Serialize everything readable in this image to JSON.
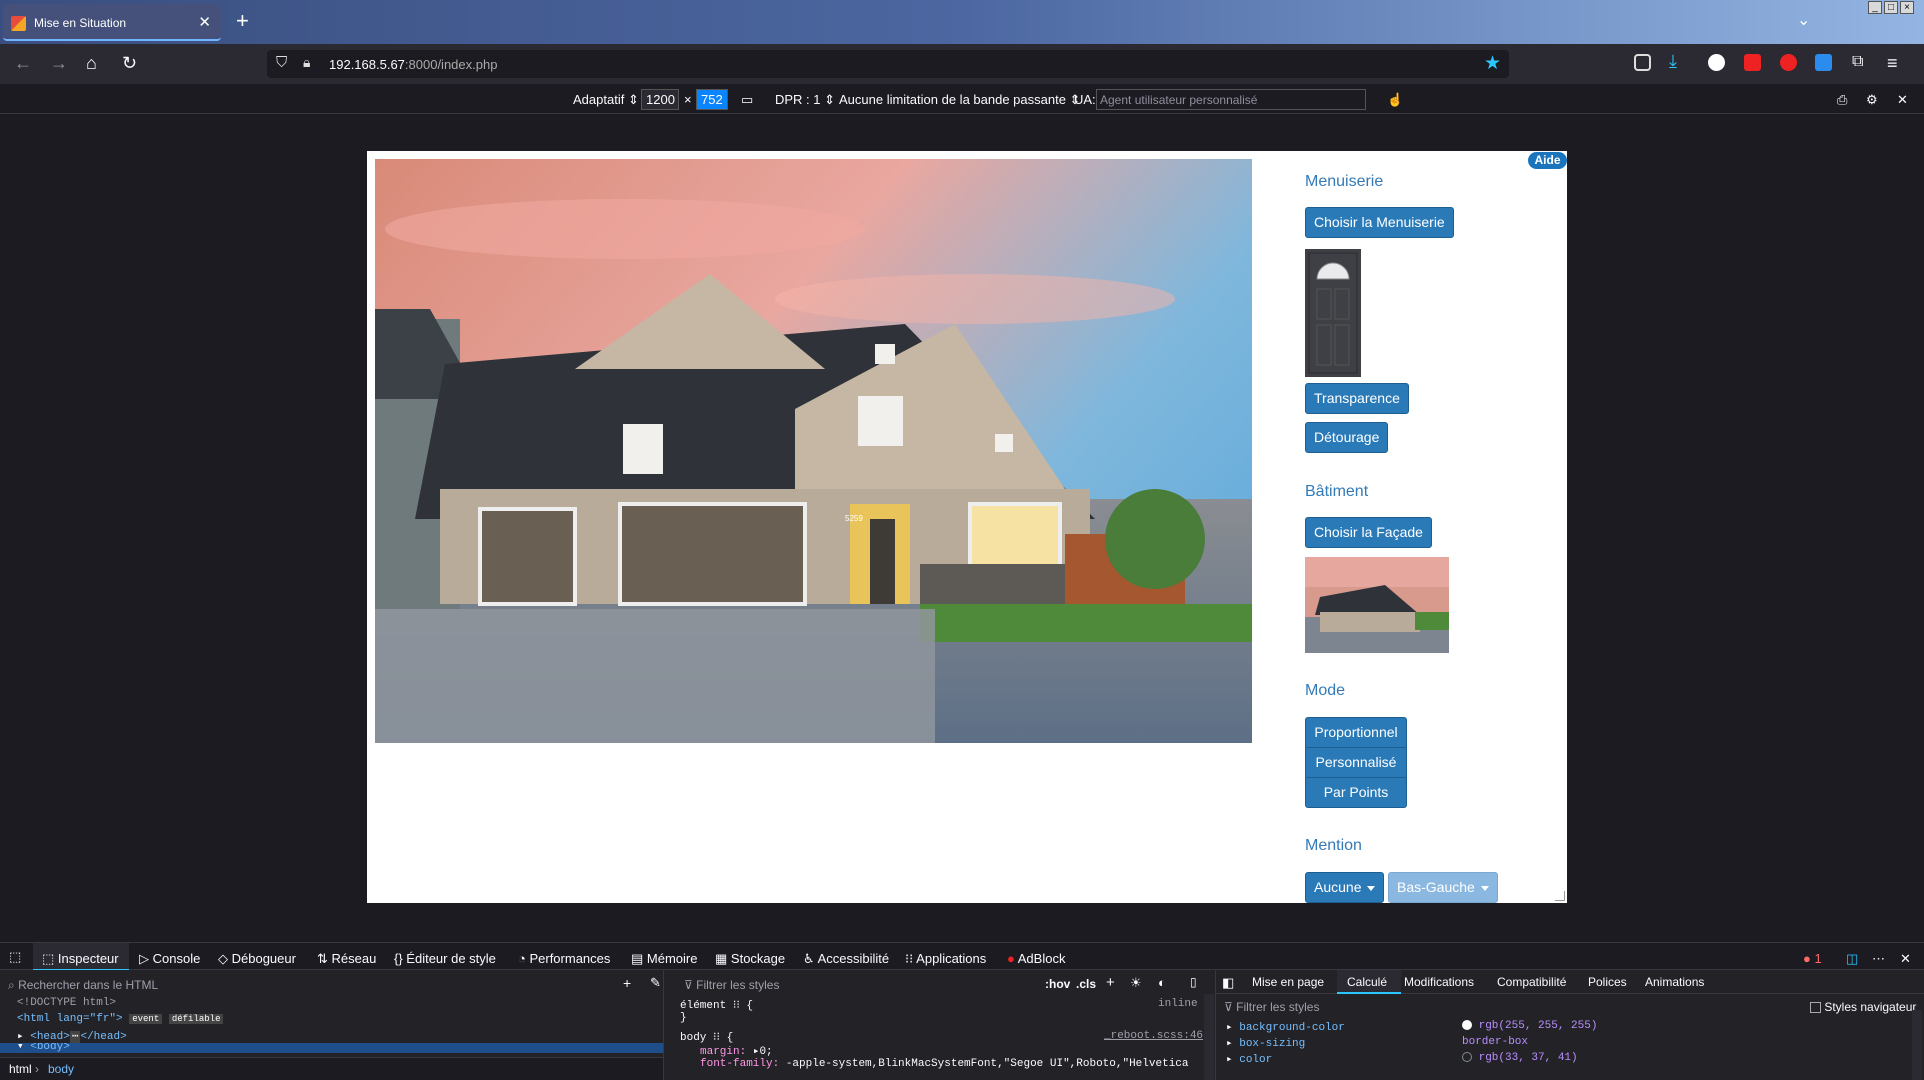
{
  "browser": {
    "tab_title": "Mise en Situation",
    "tab_close": "✕",
    "new_tab": "+",
    "list_tabs": "⌄",
    "url_host": "192.168.5.67",
    "url_rest": ":8000/index.php"
  },
  "rdm": {
    "device": "Adaptatif",
    "width": "1200",
    "x": "×",
    "height": "752",
    "dpr": "DPR : 1",
    "throttle": "Aucune limitation de la bande passante",
    "ua_label": "UA:",
    "ua_placeholder": "Agent utilisateur personnalisé"
  },
  "page": {
    "aide": "Aide",
    "menuiserie_title": "Menuiserie",
    "choisir_menuiserie": "Choisir la Menuiserie",
    "transparence": "Transparence",
    "detourage": "Détourage",
    "batiment_title": "Bâtiment",
    "choisir_facade": "Choisir la Façade",
    "mode_title": "Mode",
    "mode_buttons": [
      "Proportionnel",
      "Personnalisé",
      "Par Points"
    ],
    "mention_title": "Mention",
    "mention_value": "Aucune",
    "position_value": "Bas-Gauche",
    "house_number": "5259"
  },
  "devtools": {
    "tabs": [
      "Inspecteur",
      "Console",
      "Débogueur",
      "Réseau",
      "Éditeur de style",
      "Performances",
      "Mémoire",
      "Stockage",
      "Accessibilité",
      "Applications",
      "AdBlock"
    ],
    "error_count": "1",
    "search_html_placeholder": "Rechercher dans le HTML",
    "filter_styles_placeholder": "Filtrer les styles",
    "hov": ":hov",
    "cls": ".cls",
    "html_lines": [
      "<!DOCTYPE html>",
      "<html lang=\"fr\">",
      "event",
      "défilable",
      "<head>",
      "</head>",
      "<body>"
    ],
    "breadcrumb": [
      "html",
      "body"
    ],
    "rule_element": "élément",
    "rule_element_src": "inline",
    "rule_body": "body",
    "rule_body_src": "_reboot.scss:46",
    "margin_prop": "margin:",
    "margin_val": "0;",
    "font_prop": "font-family:",
    "font_val": "-apple-system,BlinkMacSystemFont,\"Segoe UI\",Roboto,\"Helvetica",
    "right_tabs": [
      "Mise en page",
      "Calculé",
      "Modifications",
      "Compatibilité",
      "Polices",
      "Animations"
    ],
    "filter_styles2": "Filtrer les styles",
    "browser_styles": "Styles navigateur",
    "computed": [
      {
        "prop": "background-color",
        "value": "rgb(255, 255, 255)",
        "swatch": "#ffffff"
      },
      {
        "prop": "box-sizing",
        "value": "border-box",
        "swatch": ""
      },
      {
        "prop": "color",
        "value": "rgb(33, 37, 41)",
        "swatch": "#212529"
      }
    ]
  }
}
